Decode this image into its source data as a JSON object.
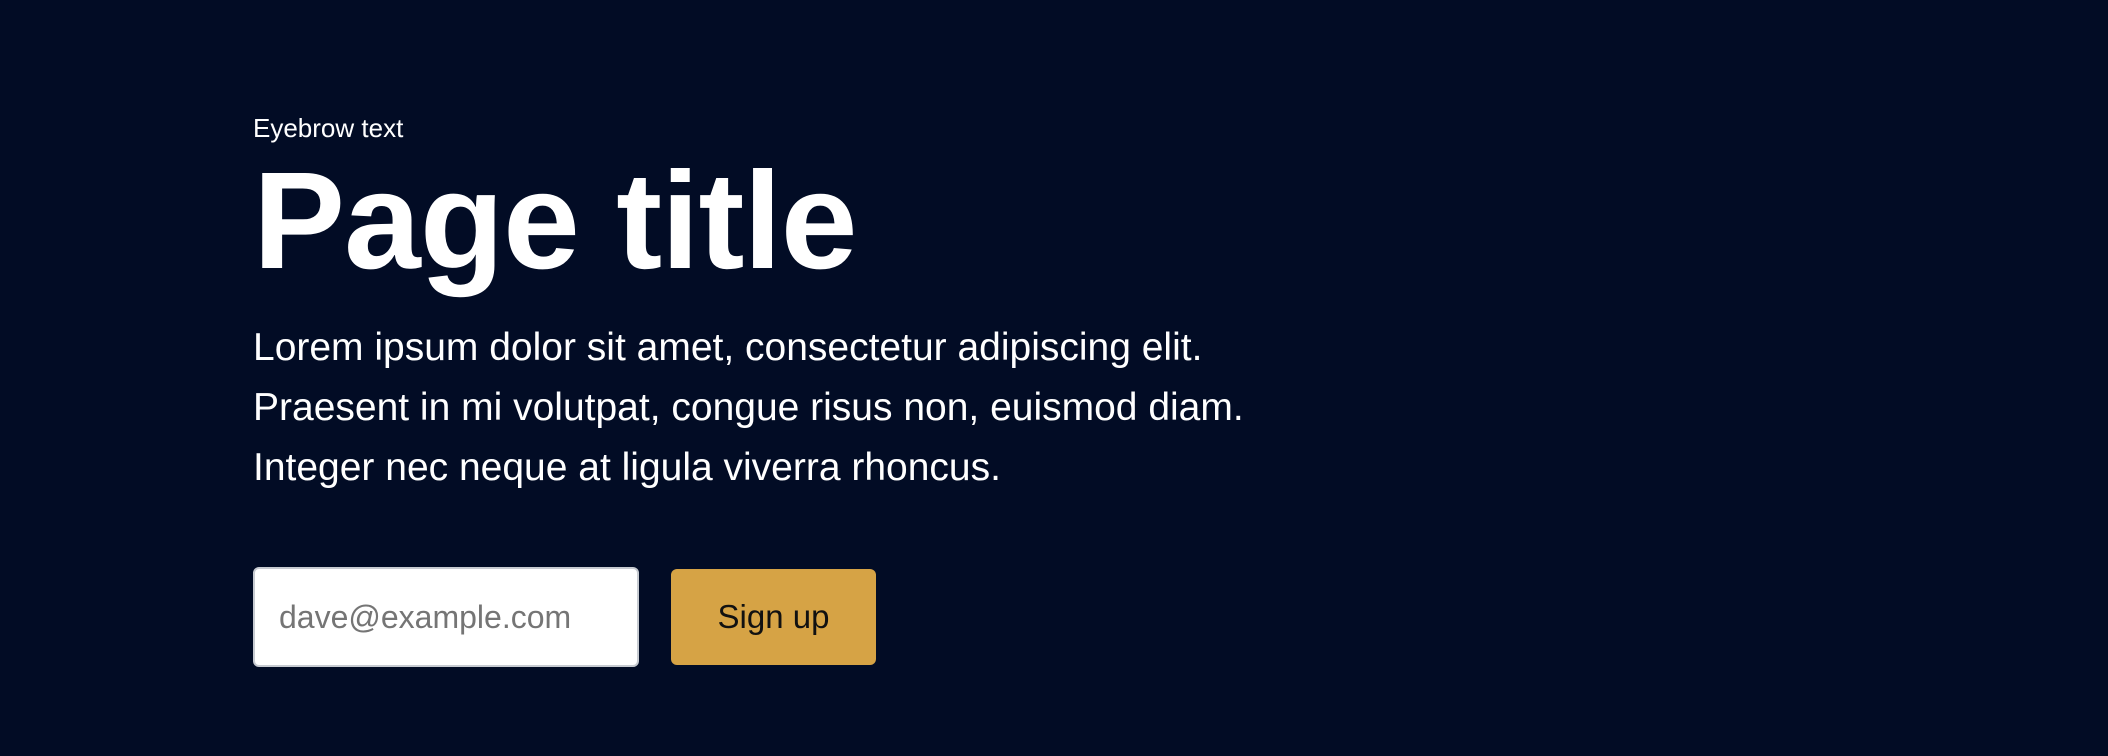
{
  "hero": {
    "eyebrow": "Eyebrow text",
    "title": "Page title",
    "body_lines": [
      "Lorem ipsum dolor sit amet, consectetur adipiscing elit.",
      "Praesent in mi volutpat, congue risus non, euismod diam.",
      "Integer nec neque at ligula viverra rhoncus."
    ]
  },
  "signup_form": {
    "email_placeholder": "dave@example.com",
    "email_value": "",
    "submit_label": "Sign up"
  },
  "colors": {
    "background": "#020c25",
    "text": "#ffffff",
    "button_accent": "#d6a345",
    "input_border": "#c7cbd1"
  }
}
